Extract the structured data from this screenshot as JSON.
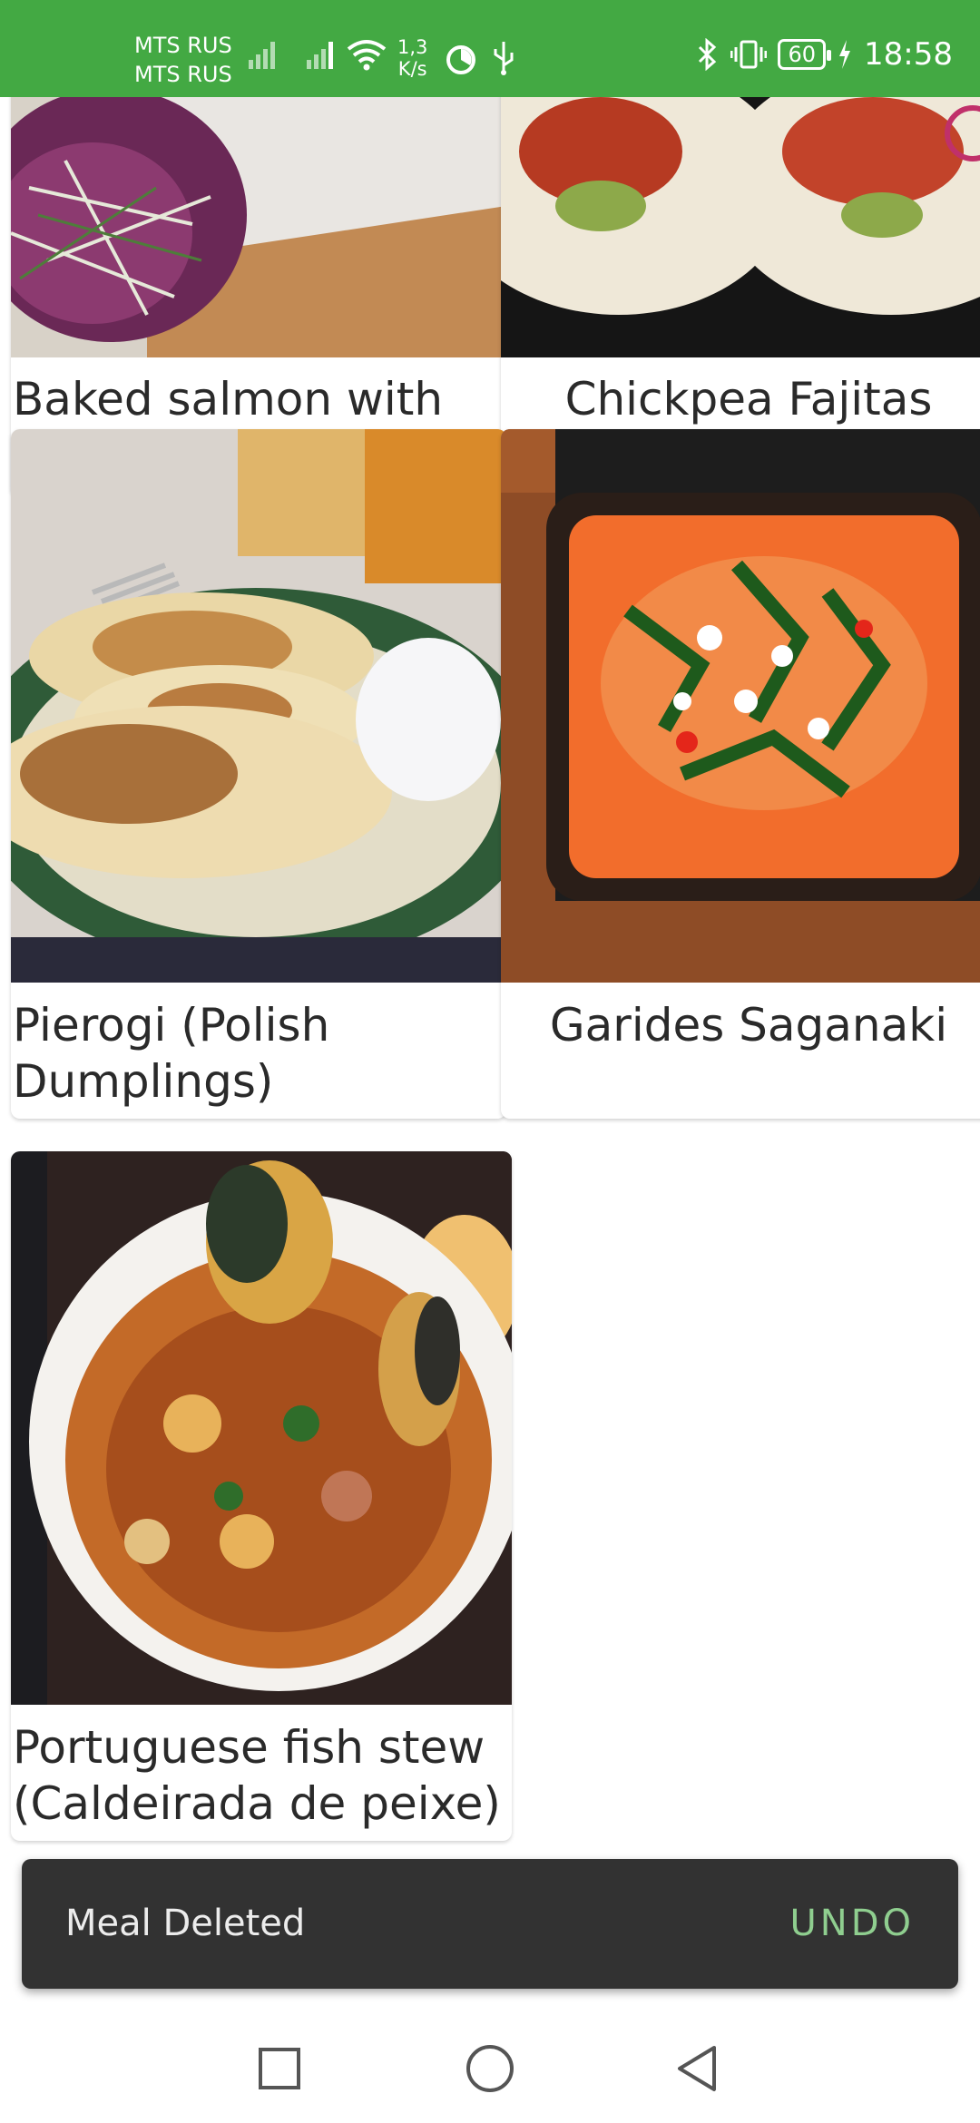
{
  "status_bar": {
    "carrier1": "MTS RUS",
    "carrier2": "MTS RUS",
    "speed_value": "1,3",
    "speed_unit": "K/s",
    "battery": "60",
    "time": "18:58",
    "icons": [
      "signal-icon",
      "signal-icon",
      "wifi-icon",
      "data-saver-icon",
      "usb-icon",
      "bluetooth-icon",
      "vibrate-icon",
      "battery-icon",
      "charging-icon"
    ]
  },
  "meals": [
    {
      "name": "Baked salmon with fennel & tomatoes"
    },
    {
      "name": "Chickpea Fajitas"
    },
    {
      "name": "Pierogi (Polish Dumplings)"
    },
    {
      "name": "Garides Saganaki"
    },
    {
      "name": "Portuguese fish stew (Caldeirada de peixe)"
    }
  ],
  "snackbar": {
    "message": "Meal Deleted",
    "action": "UNDO"
  },
  "nav": [
    "square-icon",
    "circle-icon",
    "back-icon"
  ],
  "colors": {
    "status_bar": "#43a943",
    "snackbar": "#323232",
    "undo": "#8fce8f"
  }
}
